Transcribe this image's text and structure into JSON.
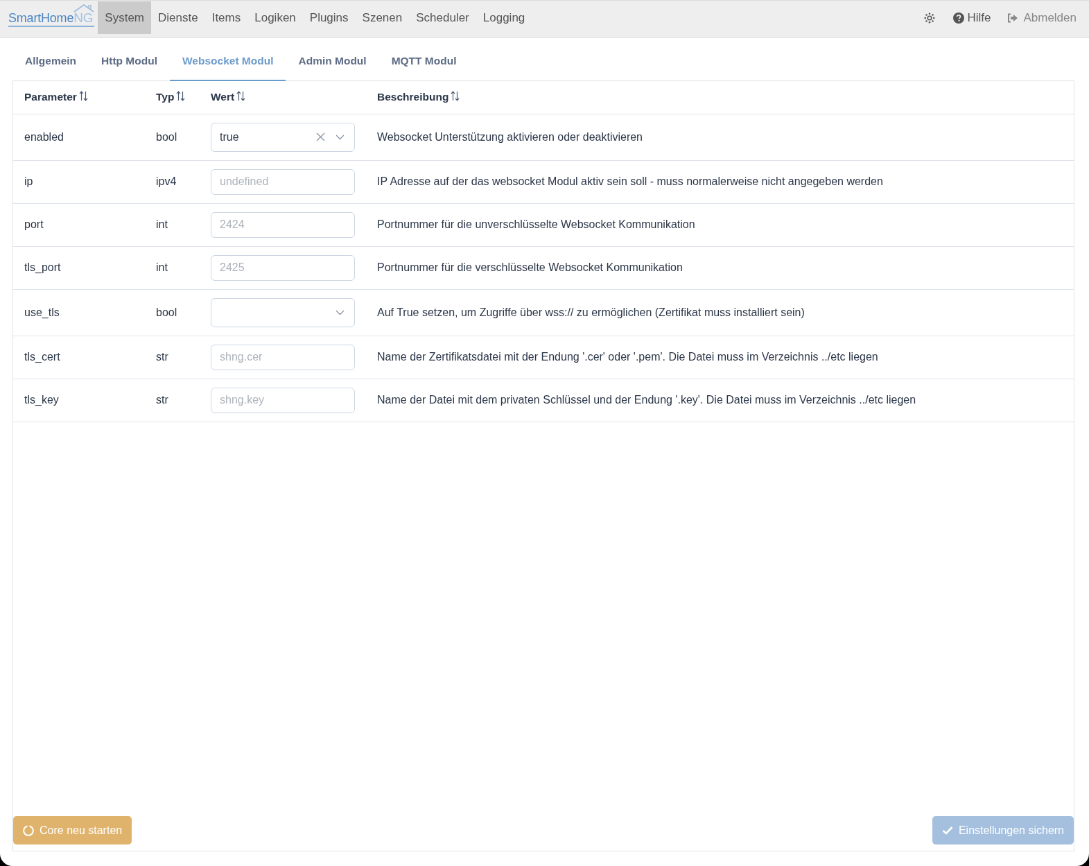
{
  "navbar": {
    "brand": {
      "text": "SmartHome",
      "accent": "NG"
    },
    "items": [
      {
        "label": "System",
        "selected": true
      },
      {
        "label": "Dienste",
        "selected": false
      },
      {
        "label": "Items",
        "selected": false
      },
      {
        "label": "Logiken",
        "selected": false
      },
      {
        "label": "Plugins",
        "selected": false
      },
      {
        "label": "Szenen",
        "selected": false
      },
      {
        "label": "Scheduler",
        "selected": false
      },
      {
        "label": "Logging",
        "selected": false
      }
    ],
    "actions": [
      {
        "kind": "theme"
      },
      {
        "kind": "help",
        "label": "Hilfe"
      },
      {
        "kind": "logout",
        "label": "Abmelden"
      }
    ]
  },
  "tabs": [
    {
      "label": "Allgemein",
      "selected": false
    },
    {
      "label": "Http Modul",
      "selected": false
    },
    {
      "label": "Websocket Modul",
      "selected": true
    },
    {
      "label": "Admin Modul",
      "selected": false
    },
    {
      "label": "MQTT Modul",
      "selected": false
    }
  ],
  "table": {
    "columns": [
      "Parameter",
      "Typ",
      "Wert",
      "Beschreibung"
    ],
    "rows": [
      {
        "parameter": "enabled",
        "type": "bool",
        "value": {
          "kind": "select",
          "value": "true"
        },
        "description": "Websocket Unterstützung aktivieren oder deaktivieren"
      },
      {
        "parameter": "ip",
        "type": "ipv4",
        "value": {
          "kind": "input",
          "placeholder": "undefined"
        },
        "description": "IP Adresse auf der das websocket Modul aktiv sein soll - muss normalerweise nicht angegeben werden"
      },
      {
        "parameter": "port",
        "type": "int",
        "value": {
          "kind": "input",
          "placeholder": "2424"
        },
        "description": "Portnummer für die unverschlüsselte Websocket Kommunikation"
      },
      {
        "parameter": "tls_port",
        "type": "int",
        "value": {
          "kind": "input",
          "placeholder": "2425"
        },
        "description": "Portnummer für die verschlüsselte Websocket Kommunikation"
      },
      {
        "parameter": "use_tls",
        "type": "bool",
        "value": {
          "kind": "select"
        },
        "description": "Auf True setzen, um Zugriffe über wss:// zu ermöglichen (Zertifikat muss installiert sein)"
      },
      {
        "parameter": "tls_cert",
        "type": "str",
        "value": {
          "kind": "input",
          "placeholder": "shng.cer"
        },
        "description": "Name der Zertifikatsdatei mit der Endung '.cer' oder '.pem'. Die Datei muss im Verzeichnis ../etc liegen"
      },
      {
        "parameter": "tls_key",
        "type": "str",
        "value": {
          "kind": "input",
          "placeholder": "shng.key"
        },
        "description": "Name der Datei mit dem privaten Schlüssel und der Endung '.key'. Die Datei muss im Verzeichnis ../etc liegen"
      }
    ]
  },
  "buttons": [
    {
      "kind": "restart",
      "label": "Core neu starten",
      "disabled": false
    },
    {
      "kind": "save",
      "label": "Einstellungen sichern",
      "disabled": true
    }
  ]
}
